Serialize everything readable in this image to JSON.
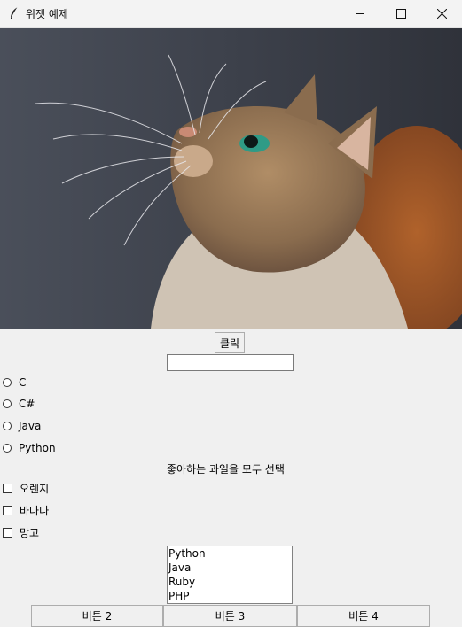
{
  "window": {
    "title": "위젯 예제",
    "icon": "feather-icon",
    "controls": [
      "minimize-icon",
      "maximize-icon",
      "close-icon"
    ]
  },
  "image": {
    "subject": "cat",
    "colors": {
      "background": "#3b3f4a",
      "fur": "#9a7a57",
      "eye": "#3aa08a"
    }
  },
  "click_button": {
    "label": "클릭"
  },
  "entry": {
    "value": ""
  },
  "radios": [
    {
      "label": "C"
    },
    {
      "label": "C#"
    },
    {
      "label": "Java"
    },
    {
      "label": "Python"
    }
  ],
  "fruit_prompt": "좋아하는 과일을 모두 선택",
  "checkboxes": [
    {
      "label": "오렌지"
    },
    {
      "label": "바나나"
    },
    {
      "label": "망고"
    }
  ],
  "listbox": {
    "items": [
      "Python",
      "Java",
      "Ruby",
      "PHP"
    ]
  },
  "bottom_buttons": [
    {
      "label": "버튼 2"
    },
    {
      "label": "버튼 3"
    },
    {
      "label": "버튼 4"
    }
  ]
}
